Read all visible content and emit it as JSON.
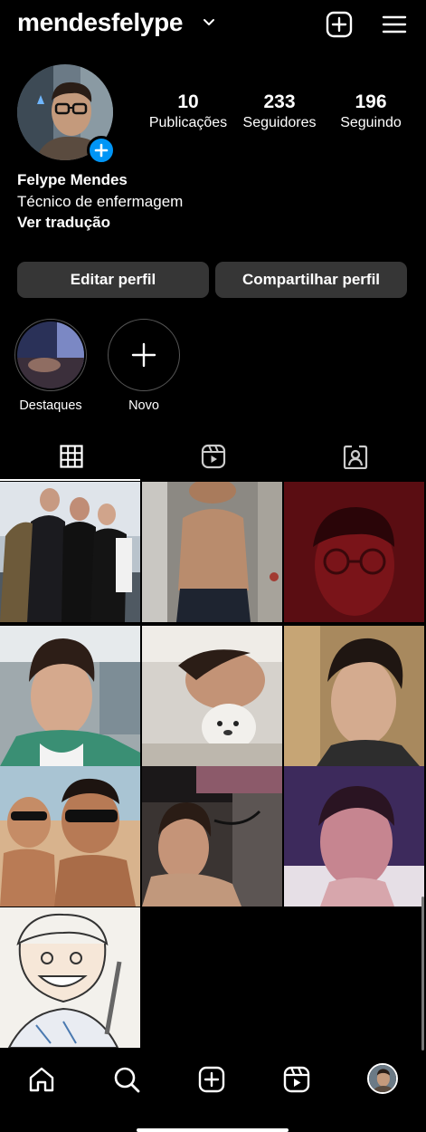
{
  "header": {
    "username": "mendesfelype",
    "icons": [
      "chevron-down-icon",
      "new-post-icon",
      "menu-icon"
    ]
  },
  "profile": {
    "stats": [
      {
        "value": "10",
        "label": "Publicações"
      },
      {
        "value": "233",
        "label": "Seguidores"
      },
      {
        "value": "196",
        "label": "Seguindo"
      }
    ],
    "name": "Felype Mendes",
    "bio": "Técnico de enfermagem",
    "translate": "Ver tradução"
  },
  "buttons": {
    "edit": "Editar perfil",
    "share": "Compartilhar perfil"
  },
  "highlights": [
    {
      "label": "Destaques"
    },
    {
      "label": "Novo"
    }
  ],
  "tabs": [
    "grid-icon",
    "reels-icon",
    "tagged-icon"
  ],
  "posts_count": 10,
  "bottom_nav": [
    "home-icon",
    "search-icon",
    "create-icon",
    "reels-icon",
    "profile-avatar"
  ],
  "colors": {
    "accent": "#0095f6",
    "button_bg": "#363636",
    "background": "#000000"
  }
}
